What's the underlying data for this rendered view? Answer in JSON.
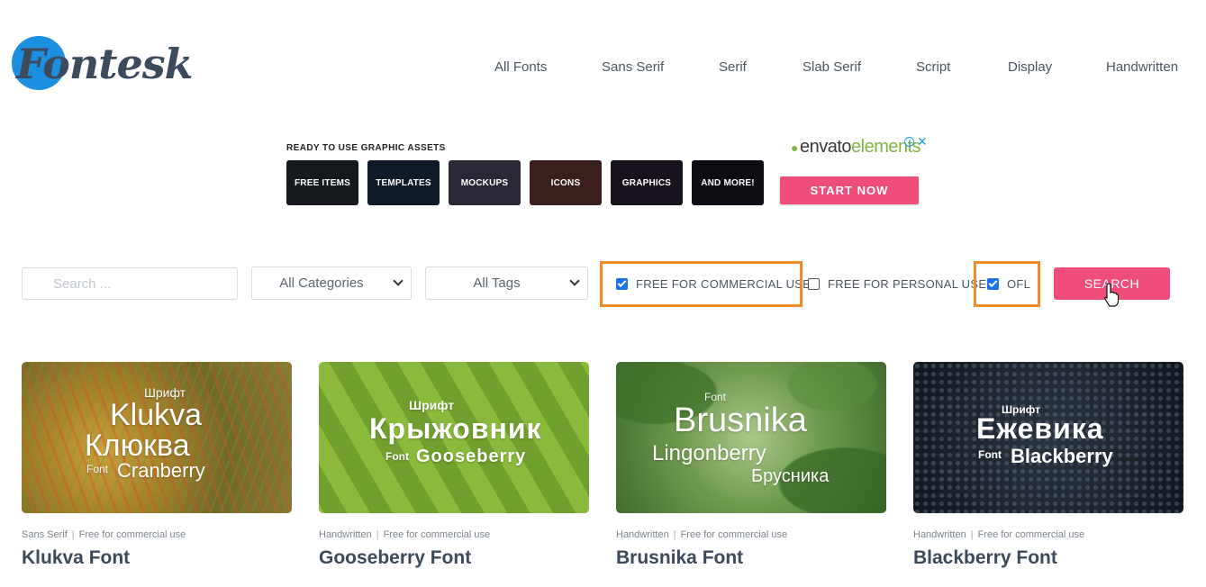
{
  "brand": {
    "logo_text": "Fontesk"
  },
  "nav": {
    "items": [
      "All Fonts",
      "Sans Serif",
      "Serif",
      "Slab Serif",
      "Script",
      "Display",
      "Handwritten"
    ]
  },
  "ad": {
    "heading": "READY TO USE GRAPHIC ASSETS",
    "tiles": [
      "FREE ITEMS",
      "TEMPLATES",
      "MOCKUPS",
      "ICONS",
      "GRAPHICS",
      "AND MORE!"
    ],
    "brand_a": "envato",
    "brand_b": "elements",
    "cta": "START NOW"
  },
  "filters": {
    "search_placeholder": "Search ...",
    "category": "All Categories",
    "tags": "All Tags",
    "checks": [
      {
        "label": "FREE FOR COMMERCIAL USE",
        "checked": true,
        "highlighted": true
      },
      {
        "label": "FREE FOR PERSONAL USE",
        "checked": false,
        "highlighted": false
      },
      {
        "label": "OFL",
        "checked": true,
        "highlighted": true
      }
    ],
    "search_button": "SEARCH"
  },
  "cards": [
    {
      "category": "Sans Serif",
      "license": "Free for commercial use",
      "title": "Klukva Font",
      "preview": [
        "Шрифт",
        "Klukva",
        "Клюква",
        "Font",
        "Cranberry"
      ]
    },
    {
      "category": "Handwritten",
      "license": "Free for commercial use",
      "title": "Gooseberry Font",
      "preview": [
        "Шрифт",
        "Крыжовник",
        "Font",
        "Gooseberry"
      ]
    },
    {
      "category": "Handwritten",
      "license": "Free for commercial use",
      "title": "Brusnika Font",
      "preview": [
        "Font",
        "Brusnika",
        "Lingonberry",
        "Брусника"
      ]
    },
    {
      "category": "Handwritten",
      "license": "Free for commercial use",
      "title": "Blackberry Font",
      "preview": [
        "Шрифт",
        "Ежевика",
        "Font",
        "Blackberry"
      ]
    }
  ],
  "colors": {
    "accent": "#f04e7a",
    "highlight": "#f28c28",
    "logo_blue": "#1d8fe1",
    "check": "#1a73e8"
  }
}
